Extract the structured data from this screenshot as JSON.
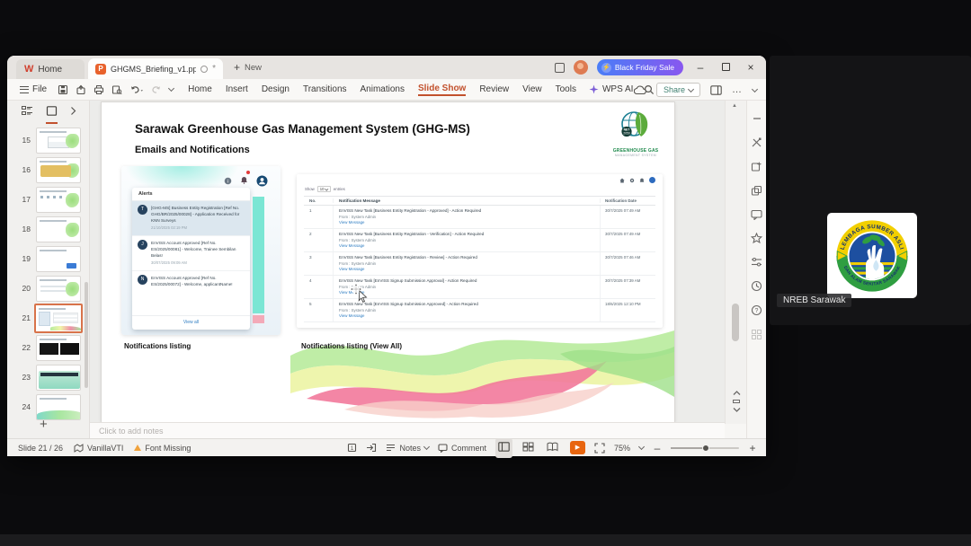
{
  "titlebar": {
    "home_tab": "Home",
    "doc_tab": "GHGMS_Briefing_v1.pptx",
    "new_tab": "New",
    "sale_button": "Black Friday Sale"
  },
  "icons": {
    "close": "×",
    "minimize": "–",
    "more": "…",
    "add": "+",
    "asterisk": "*",
    "bolt": "⚡",
    "arrow_up": "▲",
    "play": "▶"
  },
  "menubar": {
    "file": "File",
    "items": [
      "Home",
      "Insert",
      "Design",
      "Transitions",
      "Animations",
      "Slide Show",
      "Review",
      "View",
      "Tools"
    ],
    "wps_ai": "WPS AI",
    "share": "Share"
  },
  "slide_panel": {
    "numbers": [
      15,
      16,
      17,
      18,
      19,
      20,
      21,
      22,
      23,
      24
    ],
    "selected": 21
  },
  "slide": {
    "title": "Sarawak Greenhouse Gas Management System (GHG-MS)",
    "subtitle": "Emails and Notifications",
    "logo": {
      "badge_line1": "NET",
      "badge_line2": "2050",
      "name_line1": "GREENHOUSE GAS",
      "name_line2": "MANAGEMENT SYSTEM"
    },
    "alerts": {
      "header": "Alerts",
      "items": [
        {
          "avatar": "T",
          "text": "[GHG-MS] Business Entity Registration [Ref No. GHG/BR/2025/00028] - Application Received for KNN Surveys",
          "time": "21/10/2025 02:19 PM"
        },
        {
          "avatar": "J",
          "text": "EnVISS Account Approved [Ref No. ES/2025/00081] - Welcome, Trainee Sembilan Belas!",
          "time": "30/07/2025 09:09 AM"
        },
        {
          "avatar": "N",
          "text": "EnVISS Account Approved [Ref No. ES/2025/00072] - Welcome, applicantName!",
          "time": ""
        }
      ],
      "view_all": "View all"
    },
    "listing": {
      "show": "Show",
      "page_size": "10",
      "entries": "entries",
      "headers": [
        "No.",
        "Notification Message",
        "Notification Date"
      ],
      "rows": [
        {
          "no": "1",
          "msg": "EnVISS New Task [Business Entity Registration - Approved] - Action Required",
          "from": "From : System Admin",
          "link": "View Message",
          "date": "30/7/2025 07:49 AM"
        },
        {
          "no": "2",
          "msg": "EnVISS New Task [Business Entity Registration - Verification] - Action Required",
          "from": "From : System Admin",
          "link": "View Message",
          "date": "30/7/2025 07:49 AM"
        },
        {
          "no": "3",
          "msg": "EnVISS New Task [Business Entity Registration - Review] - Action Required",
          "from": "From : System Admin",
          "link": "View Message",
          "date": "30/7/2025 07:46 AM"
        },
        {
          "no": "4",
          "msg": "EnVISS New Task [EnVISS Signup Submission Approval] - Action Required",
          "from": "From : System Admin",
          "link": "View Message",
          "date": "30/7/2025 07:39 AM"
        },
        {
          "no": "5",
          "msg": "EnVISS New Task [EnVISS Signup Submission Approved] - Action Required",
          "from": "From : System Admin",
          "link": "View Message",
          "date": "18/6/2025 12:10 PM"
        }
      ]
    },
    "captions": {
      "left": "Notifications listing",
      "right": "Notifications listing (View All)"
    }
  },
  "notes_placeholder": "Click to add notes",
  "statusbar": {
    "slide_info": "Slide 21 / 26",
    "template": "VanillaVTI",
    "font_missing": "Font Missing",
    "notes": "Notes",
    "comment": "Comment",
    "zoom": "75%"
  },
  "meeting": {
    "participant": "NREB Sarawak",
    "emblem_top": "LEMBAGA SUMBER ASLI",
    "emblem_bottom": "DAN ALAM SEKITAR SARAWAK"
  },
  "colors": {
    "accent_orange": "#c2512d",
    "sale_gradient_start": "#4a7df7",
    "sale_gradient_end": "#8857ef",
    "link_blue": "#2f7dc2",
    "teal": "#7be6d4"
  }
}
